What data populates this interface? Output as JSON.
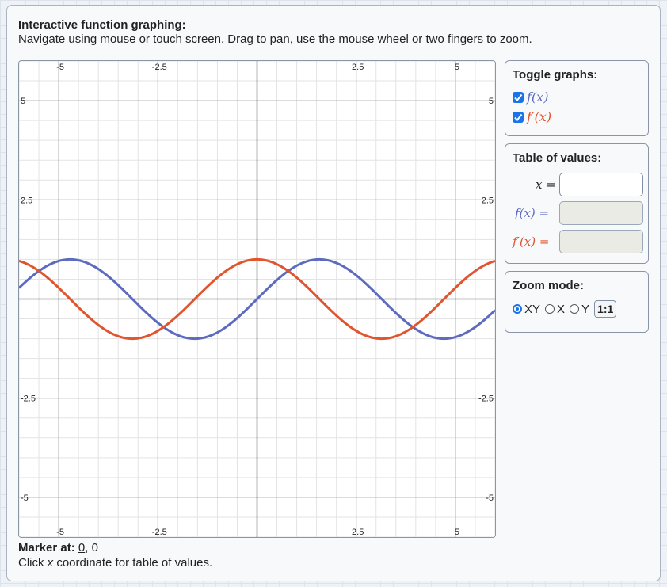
{
  "header": {
    "title": "Interactive function graphing:",
    "subtitle": "Navigate using mouse or touch screen. Drag to pan, use the mouse wheel or two fingers to zoom."
  },
  "graph": {
    "x_range": [
      -6,
      6
    ],
    "y_range": [
      -6,
      6
    ],
    "x_ticks": [
      "-5",
      "-2.5",
      "2.5",
      "5"
    ],
    "y_ticks": [
      "5",
      "2.5",
      "-2.5",
      "-5"
    ],
    "curves": [
      {
        "name": "f",
        "expr": "sin(x)",
        "color": "#5c6bc0"
      },
      {
        "name": "f'",
        "expr": "cos(x)",
        "color": "#e0542e"
      }
    ]
  },
  "toggle": {
    "heading": "Toggle graphs:",
    "items": [
      {
        "label": "f(x)",
        "checked": true,
        "color": "#5c6bc0"
      },
      {
        "label": "f′(x)",
        "checked": true,
        "color": "#e0542e"
      }
    ]
  },
  "table": {
    "heading": "Table of values:",
    "x_label": "x =",
    "f_label": "f(x) =",
    "fp_label": "f′(x) =",
    "x_value": "",
    "f_value": "",
    "fp_value": ""
  },
  "zoom": {
    "heading": "Zoom mode:",
    "options": [
      "XY",
      "X",
      "Y"
    ],
    "selected": "XY",
    "ratio_button": "1:1"
  },
  "marker": {
    "label": "Marker at:",
    "x": "0",
    "separator": ",",
    "y": "0",
    "hint_pre": "Click ",
    "hint_var": "x",
    "hint_post": " coordinate for table of values."
  },
  "colors": {
    "f": "#5c6bc0",
    "fprime": "#e0542e",
    "accent": "#1a73e8"
  }
}
